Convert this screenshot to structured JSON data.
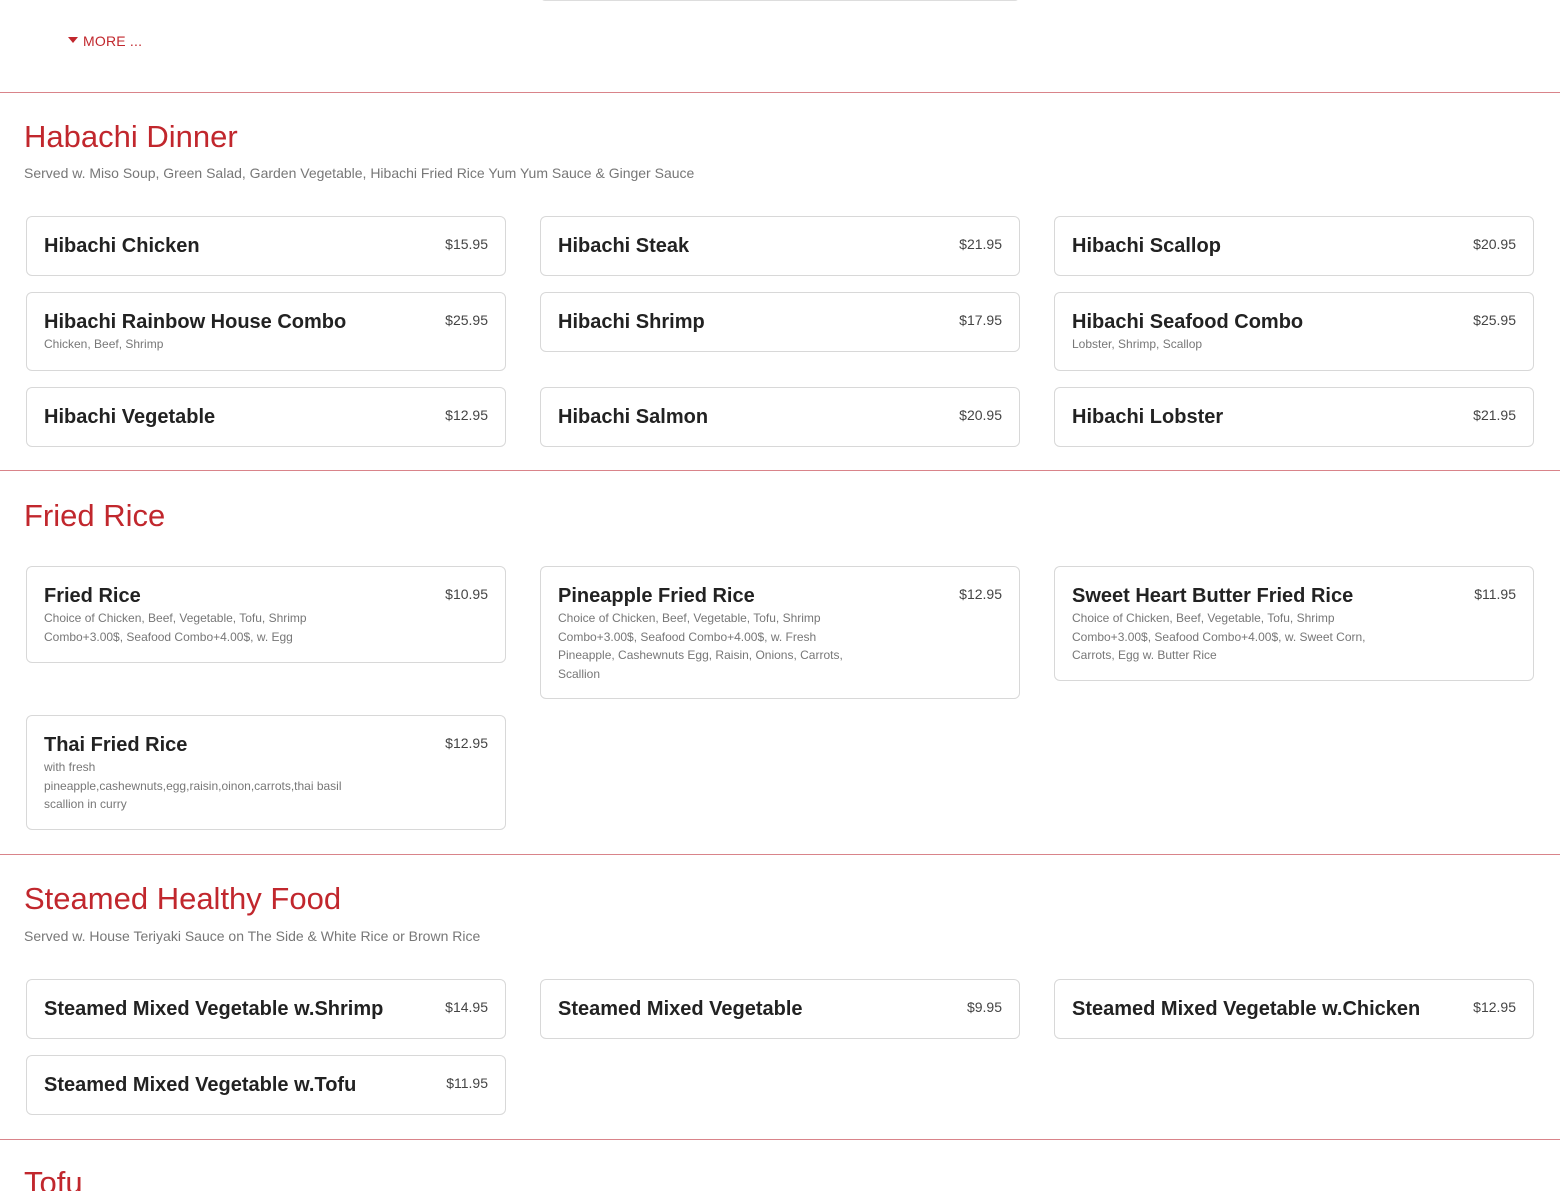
{
  "more_label": "MORE ...",
  "accent": "#c1272d",
  "sections": [
    {
      "title": "Habachi Dinner",
      "subtitle": "Served w. Miso Soup, Green Salad, Garden Vegetable, Hibachi Fried Rice Yum Yum Sauce & Ginger Sauce",
      "items": [
        {
          "name": "Hibachi Chicken",
          "price": "$15.95",
          "desc": ""
        },
        {
          "name": "Hibachi Steak",
          "price": "$21.95",
          "desc": ""
        },
        {
          "name": "Hibachi Scallop",
          "price": "$20.95",
          "desc": ""
        },
        {
          "name": "Hibachi Rainbow House Combo",
          "price": "$25.95",
          "desc": "Chicken, Beef, Shrimp"
        },
        {
          "name": "Hibachi Shrimp",
          "price": "$17.95",
          "desc": ""
        },
        {
          "name": "Hibachi Seafood Combo",
          "price": "$25.95",
          "desc": "Lobster, Shrimp, Scallop"
        },
        {
          "name": "Hibachi Vegetable",
          "price": "$12.95",
          "desc": ""
        },
        {
          "name": "Hibachi Salmon",
          "price": "$20.95",
          "desc": ""
        },
        {
          "name": "Hibachi Lobster",
          "price": "$21.95",
          "desc": ""
        }
      ]
    },
    {
      "title": "Fried Rice",
      "subtitle": "",
      "items": [
        {
          "name": "Fried Rice",
          "price": "$10.95",
          "desc": "Choice of Chicken, Beef, Vegetable, Tofu, Shrimp Combo+3.00$, Seafood Combo+4.00$, w. Egg"
        },
        {
          "name": "Pineapple Fried Rice",
          "price": "$12.95",
          "desc": "Choice of Chicken, Beef, Vegetable, Tofu, Shrimp Combo+3.00$, Seafood Combo+4.00$, w. Fresh Pineapple, Cashewnuts Egg, Raisin, Onions, Carrots, Scallion"
        },
        {
          "name": "Sweet Heart Butter Fried Rice",
          "price": "$11.95",
          "desc": "Choice of Chicken, Beef, Vegetable, Tofu, Shrimp Combo+3.00$, Seafood Combo+4.00$, w. Sweet Corn, Carrots, Egg w. Butter Rice"
        },
        {
          "name": "Thai Fried Rice",
          "price": "$12.95",
          "desc": "with fresh pineapple,cashewnuts,egg,raisin,oinon,carrots,thai basil scallion in curry"
        }
      ]
    },
    {
      "title": "Steamed Healthy Food",
      "subtitle": "Served w. House Teriyaki Sauce on The Side & White Rice or Brown Rice",
      "items": [
        {
          "name": "Steamed Mixed Vegetable w.Shrimp",
          "price": "$14.95",
          "desc": ""
        },
        {
          "name": "Steamed Mixed Vegetable",
          "price": "$9.95",
          "desc": ""
        },
        {
          "name": "Steamed Mixed Vegetable w.Chicken",
          "price": "$12.95",
          "desc": ""
        },
        {
          "name": "Steamed Mixed Vegetable w.Tofu",
          "price": "$11.95",
          "desc": ""
        }
      ]
    },
    {
      "title": "Tofu",
      "subtitle": "",
      "items": []
    }
  ]
}
